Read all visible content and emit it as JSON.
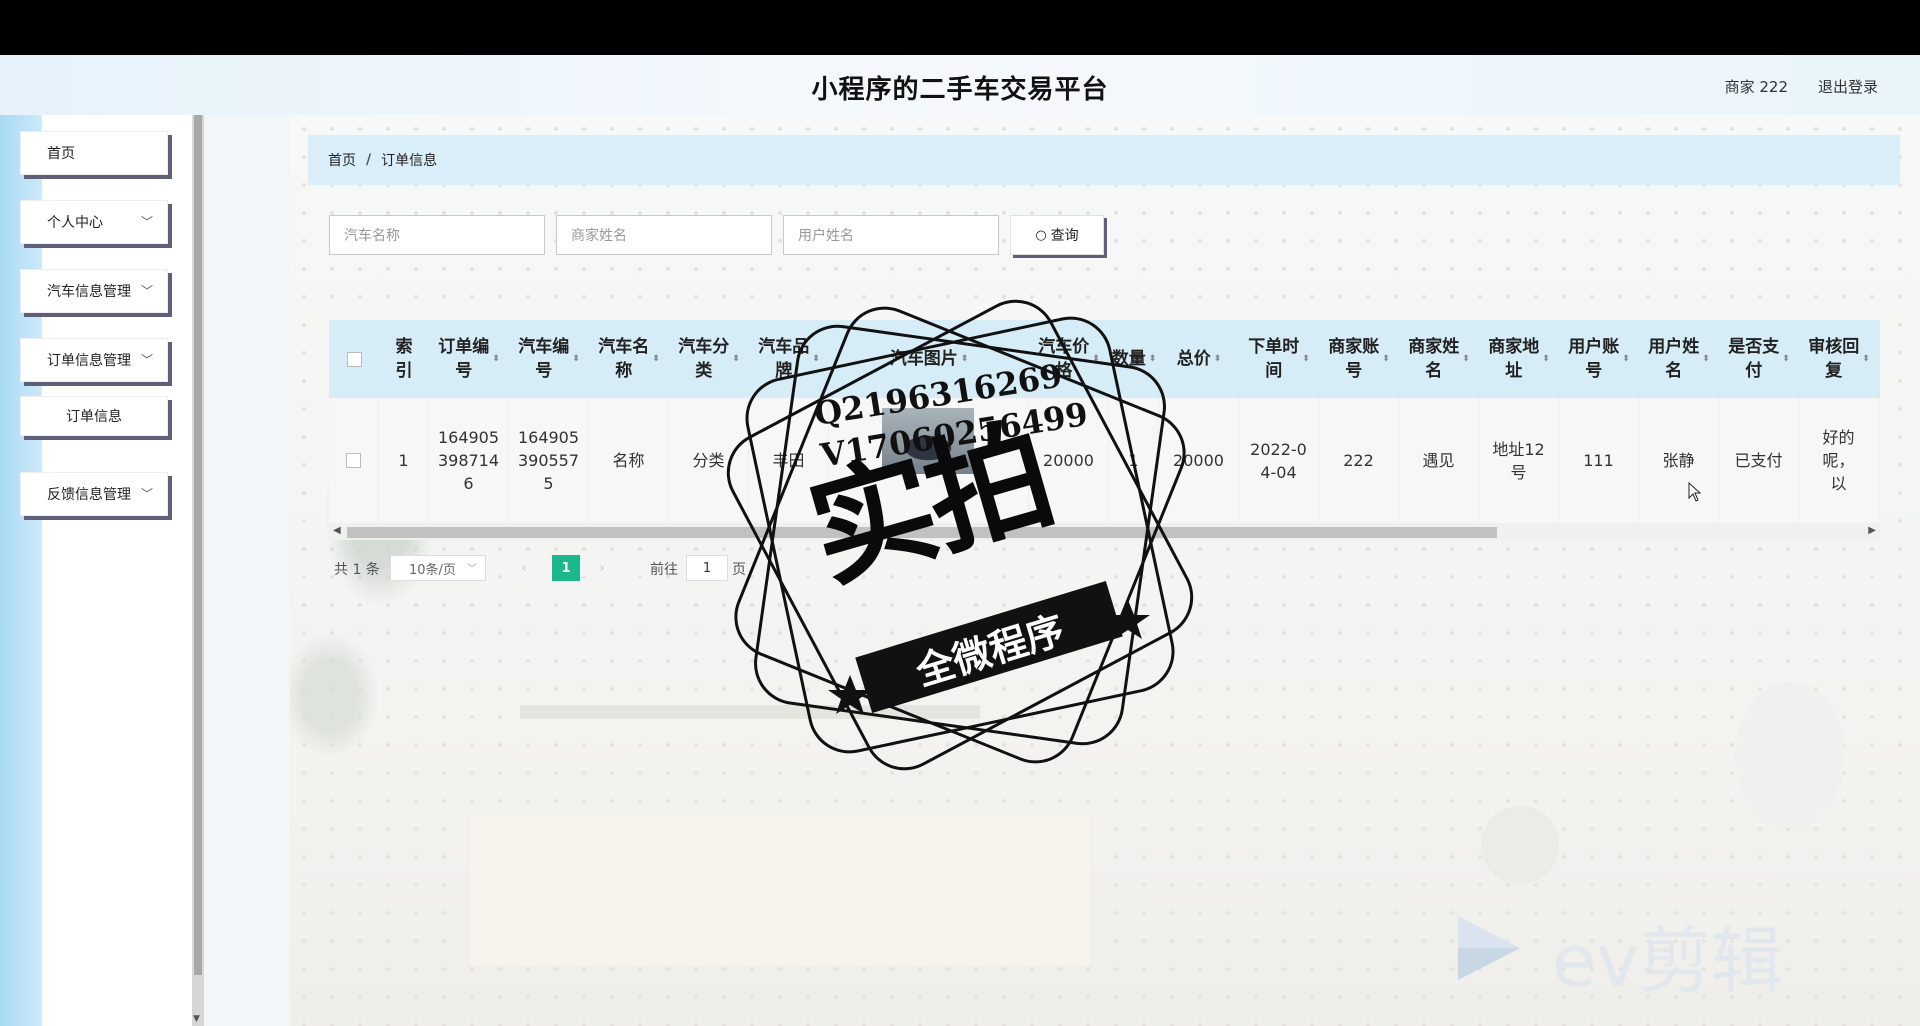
{
  "header": {
    "title": "小程序的二手车交易平台",
    "user_label": "商家 222",
    "logout_label": "退出登录"
  },
  "sidebar": {
    "items": [
      {
        "label": "首页",
        "has_arrow": false
      },
      {
        "label": "个人中心",
        "has_arrow": true
      },
      {
        "label": "汽车信息管理",
        "has_arrow": true
      },
      {
        "label": "订单信息管理",
        "has_arrow": true
      },
      {
        "label": "订单信息",
        "has_arrow": false,
        "sub": true
      },
      {
        "label": "反馈信息管理",
        "has_arrow": true
      }
    ]
  },
  "breadcrumb": {
    "home": "首页",
    "separator": "/",
    "current": "订单信息"
  },
  "search": {
    "car_name_placeholder": "汽车名称",
    "merchant_name_placeholder": "商家姓名",
    "user_name_placeholder": "用户姓名",
    "button_label": "查询",
    "button_icon": "search-icon"
  },
  "table": {
    "columns": [
      "索引",
      "订单编号",
      "汽车编号",
      "汽车名称",
      "汽车分类",
      "汽车品牌",
      "汽车图片",
      "汽车价格",
      "数量",
      "总价",
      "下单时间",
      "商家账号",
      "商家姓名",
      "商家地址",
      "用户账号",
      "用户姓名",
      "是否支付",
      "审核回复"
    ],
    "columns_display": [
      "索\n引",
      "订单编\n号",
      "汽车编\n号",
      "汽车名\n称",
      "汽车分\n类",
      "汽车品\n牌",
      "汽车图片",
      "汽车价\n格",
      "数量",
      "总价",
      "下单时\n间",
      "商家账\n号",
      "商家姓\n名",
      "商家地\n址",
      "用户账\n号",
      "用户姓\n名",
      "是否支\n付",
      "审核回\n复"
    ],
    "rows": [
      {
        "index": "1",
        "order_no": "164905398714 6",
        "order_no_display": "164905\n398714\n6",
        "car_no": "1649053905575",
        "car_no_display": "164905\n390557\n5",
        "car_name": "名称",
        "category": "分类",
        "brand": "丰田",
        "price": "20000",
        "quantity": "1",
        "total": "20000",
        "order_time": "2022-04-04",
        "order_time_display": "2022-0\n4-04",
        "merchant_account": "222",
        "merchant_name": "遇见",
        "merchant_address": "地址12号",
        "merchant_address_display": "地址12\n号",
        "user_account": "111",
        "user_name": "张静",
        "paid": "已支付",
        "review_reply_display": "好的\n呢，\n以"
      }
    ]
  },
  "pagination": {
    "total_label": "共 1 条",
    "page_size": "10条/页",
    "current_page": "1",
    "goto_prefix": "前往",
    "goto_value": "1",
    "goto_suffix": "页"
  },
  "watermark": {
    "contact_line1": "Q2196316269",
    "contact_line2": "V17060256499",
    "stamp_main": "实拍",
    "stamp_ribbon": "全微程序",
    "video_editor": "ev剪辑"
  },
  "colors": {
    "accent_green": "#1cb78a",
    "header_blue": "#e7f2fb",
    "breadcrumb_bg": "#d9eef9",
    "table_header_bg": "#d6ecf7",
    "button_shadow": "#5f5f78"
  }
}
